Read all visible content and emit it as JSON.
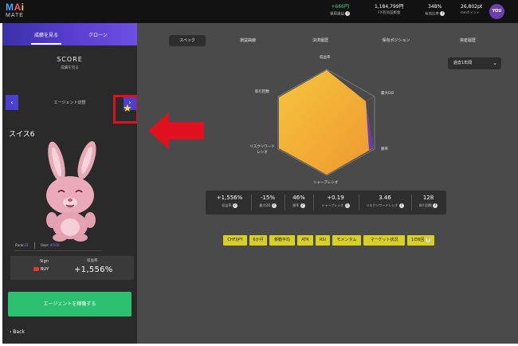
{
  "logo": {
    "line1_m": "M",
    "line1_a": "A",
    "line1_i": "i",
    "line2": "MATE"
  },
  "header": {
    "stats": [
      {
        "value": "+666円",
        "label": "運用損益",
        "color": "green"
      },
      {
        "value": "1,184,799円",
        "label": "FX有効証拠金",
        "color": "white"
      },
      {
        "value": "348%",
        "label": "有効比率",
        "color": "white"
      }
    ],
    "points_value": "26,802pt",
    "points_label": "mmポイント",
    "avatar": "YOU"
  },
  "left": {
    "tabs": [
      "成績を見る",
      "クローン"
    ],
    "score_title": "SCORE",
    "score_sub": "成績を見る",
    "switch_label": "エージェント切替",
    "prev_icon": "‹",
    "next_icon": "›",
    "agent_name": "スイス6",
    "rank_label": "Rank",
    "rank_value": "03",
    "user_label": "User",
    "user_value": "4/500",
    "sign_title": "Sign",
    "sign_value": "BUY",
    "return_label": "収益率",
    "return_value": "+1,556%",
    "follow_button": "エージェントを稼働する",
    "back": "‹ Back"
  },
  "main": {
    "tabs": [
      "スペック",
      "損益曲線",
      "決済履歴",
      "保有ポジション",
      "資産履歴"
    ],
    "period": "過去1年間",
    "radar_labels": [
      "収益率",
      "最大DD",
      "勝率",
      "シャープレシオ",
      "リスクリワード\nレシオ",
      "取引回数"
    ],
    "metrics": [
      {
        "value": "+1,556%",
        "label": "収益率"
      },
      {
        "value": "-15%",
        "label": "最大DD"
      },
      {
        "value": "46%",
        "label": "勝率"
      },
      {
        "value": "+0.19",
        "label": "シャープレシオ"
      },
      {
        "value": "3.46",
        "label": "リスクリワードレシオ"
      },
      {
        "value": "128",
        "label": "取引回数"
      }
    ],
    "chips": [
      "CHF/JPY",
      "6か月",
      "移動平均",
      "ATR",
      "RSI",
      "モメンタム",
      "マーケット状況",
      "1日6回"
    ]
  },
  "colors": {
    "accent": "#4a3fcf",
    "follow": "#2cc071",
    "chip": "#d8cf27",
    "radar_fill": "#f2b13a",
    "highlight": "#e0101e",
    "star": "#ffe135"
  }
}
